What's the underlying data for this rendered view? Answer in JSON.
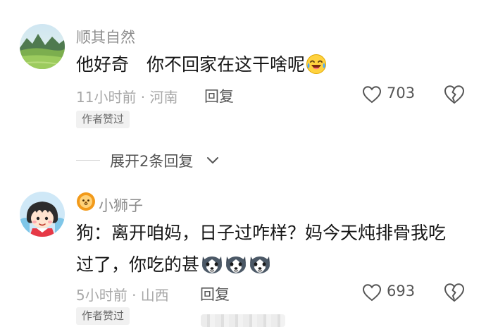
{
  "comments": [
    {
      "username": "顺其自然",
      "text": "他好奇　你不回家在这干啥呢",
      "emoji": "laughing-crying-emoji",
      "time_location": "11小时前 · 河南",
      "reply_label": "回复",
      "likes": "703",
      "author_tag": "作者赞过"
    },
    {
      "username": "小狮子",
      "text_line1": "狗：离开咱妈，日子过咋样？妈今天炖排骨我吃",
      "text_line2": "过了，你吃的甚",
      "emoji": "husky-dog-emoji",
      "emoji_count": 3,
      "time_location": "5小时前 · 山西",
      "reply_label": "回复",
      "likes": "693",
      "author_tag": "作者赞过"
    }
  ],
  "expand_replies": {
    "label": "展开2条回复"
  },
  "colors": {
    "username": "#8d8d8d",
    "body_text": "#161616",
    "meta": "#a8a8a8",
    "action": "#555555",
    "tag_bg": "#f1f1f1"
  }
}
